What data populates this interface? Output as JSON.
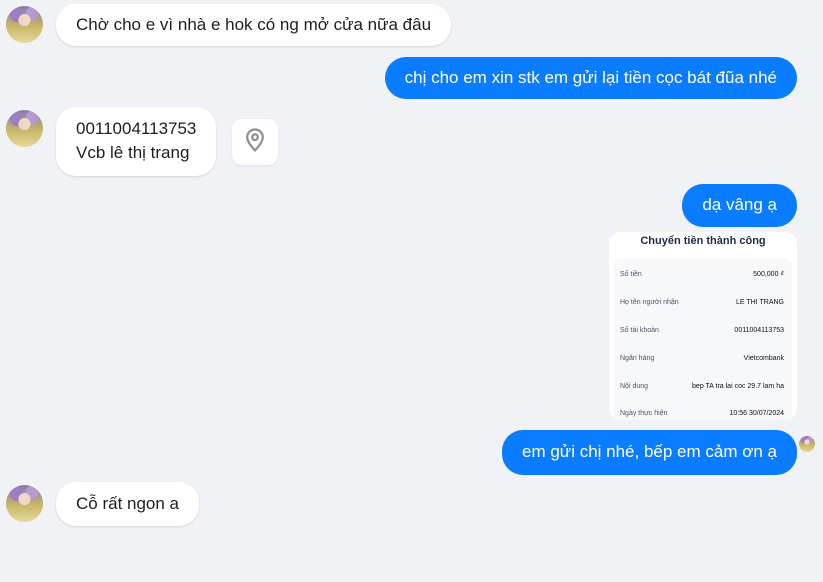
{
  "messages": {
    "m1": {
      "text": "Chờ cho e vì nhà e hok có ng mở cửa nữa đâu"
    },
    "m2": {
      "text": "chị cho em xin stk em gửi lại tiền cọc bát đũa nhé"
    },
    "m3": {
      "line1": "0011004113753",
      "line2": "Vcb lê thị trang"
    },
    "m4": {
      "text": "dạ vâng ạ"
    },
    "m5": {
      "text": "em gửi chị nhé, bếp em cảm ơn ạ"
    },
    "m6": {
      "text": "Cỗ rất ngon a"
    }
  },
  "receipt": {
    "title": "Chuyển tiền thành công",
    "rows": [
      {
        "label": "Số tiền",
        "value": "500,000 ₫"
      },
      {
        "label": "Họ tên người nhận",
        "value": "LE THI TRANG"
      },
      {
        "label": "Số tài khoản",
        "value": "0011004113753"
      },
      {
        "label": "Ngân hàng",
        "value": "Vietcombank"
      },
      {
        "label": "Nội dung",
        "value": "bep TA tra lai coc 29.7 lam ha"
      },
      {
        "label": "Ngày thực hiện",
        "value": "10:56 30/07/2024"
      }
    ]
  },
  "icons": {
    "location": "location-pin-icon"
  },
  "colors": {
    "outgoing": "#0a7cff",
    "incoming": "#ffffff",
    "background": "#f0f2f5"
  }
}
